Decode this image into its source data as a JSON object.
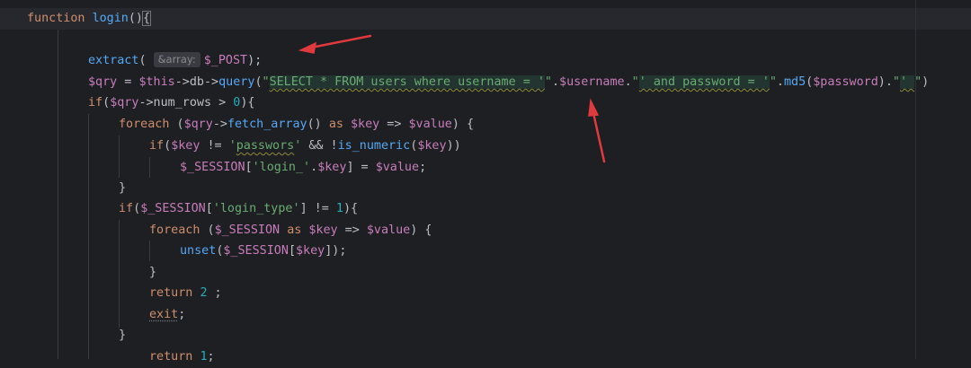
{
  "editor": {
    "lines": [
      {
        "tokens": [
          {
            "t": "kw",
            "v": "function "
          },
          {
            "t": "fn",
            "v": "login"
          },
          {
            "t": "plain",
            "v": "()"
          },
          {
            "t": "brace",
            "v": "{"
          }
        ]
      },
      {
        "tokens": []
      },
      {
        "tokens": [
          {
            "t": "fn",
            "v": "extract"
          },
          {
            "t": "plain",
            "v": "( "
          },
          {
            "t": "hint",
            "v": "&array:"
          },
          {
            "t": "var",
            "v": "$_POST"
          },
          {
            "t": "plain",
            "v": ");"
          }
        ]
      },
      {
        "tokens": [
          {
            "t": "var",
            "v": "$qry"
          },
          {
            "t": "plain",
            "v": " = "
          },
          {
            "t": "var",
            "v": "$this"
          },
          {
            "t": "plain",
            "v": "->"
          },
          {
            "t": "plain",
            "v": "db"
          },
          {
            "t": "plain",
            "v": "->"
          },
          {
            "t": "fn",
            "v": "query"
          },
          {
            "t": "plain",
            "v": "("
          },
          {
            "t": "str",
            "v": "\""
          },
          {
            "t": "sql",
            "v": "SELECT * FROM users where username = '"
          },
          {
            "t": "str",
            "v": "\""
          },
          {
            "t": "plain",
            "v": "."
          },
          {
            "t": "var",
            "v": "$username"
          },
          {
            "t": "plain",
            "v": "."
          },
          {
            "t": "str",
            "v": "\""
          },
          {
            "t": "sql",
            "v": "' and password = '"
          },
          {
            "t": "str",
            "v": "\""
          },
          {
            "t": "plain",
            "v": "."
          },
          {
            "t": "fn",
            "v": "md5"
          },
          {
            "t": "plain",
            "v": "("
          },
          {
            "t": "var",
            "v": "$password"
          },
          {
            "t": "plain",
            "v": ")."
          },
          {
            "t": "str",
            "v": "\""
          },
          {
            "t": "sql",
            "v": "' "
          },
          {
            "t": "str",
            "v": "\""
          },
          {
            "t": "plain",
            "v": ")"
          }
        ]
      },
      {
        "tokens": [
          {
            "t": "kw",
            "v": "if"
          },
          {
            "t": "plain",
            "v": "("
          },
          {
            "t": "var",
            "v": "$qry"
          },
          {
            "t": "plain",
            "v": "->num_rows > "
          },
          {
            "t": "num",
            "v": "0"
          },
          {
            "t": "plain",
            "v": "){"
          }
        ]
      },
      {
        "tokens": [
          {
            "t": "kw",
            "v": "foreach"
          },
          {
            "t": "plain",
            "v": " ("
          },
          {
            "t": "var",
            "v": "$qry"
          },
          {
            "t": "plain",
            "v": "->"
          },
          {
            "t": "fn",
            "v": "fetch_array"
          },
          {
            "t": "plain",
            "v": "() "
          },
          {
            "t": "kw",
            "v": "as"
          },
          {
            "t": "plain",
            "v": " "
          },
          {
            "t": "var",
            "v": "$key"
          },
          {
            "t": "plain",
            "v": " => "
          },
          {
            "t": "var",
            "v": "$value"
          },
          {
            "t": "plain",
            "v": ") {"
          }
        ]
      },
      {
        "tokens": [
          {
            "t": "kw",
            "v": "if"
          },
          {
            "t": "plain",
            "v": "("
          },
          {
            "t": "var",
            "v": "$key"
          },
          {
            "t": "plain",
            "v": " != "
          },
          {
            "t": "str",
            "v": "'"
          },
          {
            "t": "strsq",
            "v": "passwors"
          },
          {
            "t": "str",
            "v": "'"
          },
          {
            "t": "plain",
            "v": " && !"
          },
          {
            "t": "fn",
            "v": "is_numeric"
          },
          {
            "t": "plain",
            "v": "("
          },
          {
            "t": "var",
            "v": "$key"
          },
          {
            "t": "plain",
            "v": "))"
          }
        ]
      },
      {
        "tokens": [
          {
            "t": "var",
            "v": "$_SESSION"
          },
          {
            "t": "plain",
            "v": "["
          },
          {
            "t": "str",
            "v": "'login_'"
          },
          {
            "t": "plain",
            "v": "."
          },
          {
            "t": "var",
            "v": "$key"
          },
          {
            "t": "plain",
            "v": "] = "
          },
          {
            "t": "var",
            "v": "$value"
          },
          {
            "t": "plain",
            "v": ";"
          }
        ]
      },
      {
        "tokens": [
          {
            "t": "plain",
            "v": "}"
          }
        ]
      },
      {
        "tokens": [
          {
            "t": "kw",
            "v": "if"
          },
          {
            "t": "plain",
            "v": "("
          },
          {
            "t": "var",
            "v": "$_SESSION"
          },
          {
            "t": "plain",
            "v": "["
          },
          {
            "t": "str",
            "v": "'login_type'"
          },
          {
            "t": "plain",
            "v": "] != "
          },
          {
            "t": "num",
            "v": "1"
          },
          {
            "t": "plain",
            "v": "){"
          }
        ]
      },
      {
        "tokens": [
          {
            "t": "kw",
            "v": "foreach"
          },
          {
            "t": "plain",
            "v": " ("
          },
          {
            "t": "var",
            "v": "$_SESSION"
          },
          {
            "t": "plain",
            "v": " "
          },
          {
            "t": "kw",
            "v": "as"
          },
          {
            "t": "plain",
            "v": " "
          },
          {
            "t": "var",
            "v": "$key"
          },
          {
            "t": "plain",
            "v": " => "
          },
          {
            "t": "var",
            "v": "$value"
          },
          {
            "t": "plain",
            "v": ") {"
          }
        ]
      },
      {
        "tokens": [
          {
            "t": "fn",
            "v": "unset"
          },
          {
            "t": "plain",
            "v": "("
          },
          {
            "t": "var",
            "v": "$_SESSION"
          },
          {
            "t": "plain",
            "v": "["
          },
          {
            "t": "var",
            "v": "$key"
          },
          {
            "t": "plain",
            "v": "]);"
          }
        ]
      },
      {
        "tokens": [
          {
            "t": "plain",
            "v": "}"
          }
        ]
      },
      {
        "tokens": [
          {
            "t": "kw",
            "v": "return"
          },
          {
            "t": "plain",
            "v": " "
          },
          {
            "t": "num",
            "v": "2"
          },
          {
            "t": "plain",
            "v": " ;"
          }
        ]
      },
      {
        "tokens": [
          {
            "t": "kwdot",
            "v": "exit"
          },
          {
            "t": "plain",
            "v": ";"
          }
        ]
      },
      {
        "tokens": [
          {
            "t": "plain",
            "v": "}"
          }
        ]
      },
      {
        "tokens": [
          {
            "t": "kw",
            "v": "return"
          },
          {
            "t": "plain",
            "v": " "
          },
          {
            "t": "num",
            "v": "1"
          },
          {
            "t": "plain",
            "v": ";"
          }
        ]
      }
    ]
  },
  "colors": {
    "background": "#1e1f22",
    "keyword": "#cf8e6d",
    "function": "#56a8f5",
    "variable": "#c77dbb",
    "string": "#6aab73",
    "number": "#2aacb8",
    "annotation_arrow": "#e0393e"
  }
}
